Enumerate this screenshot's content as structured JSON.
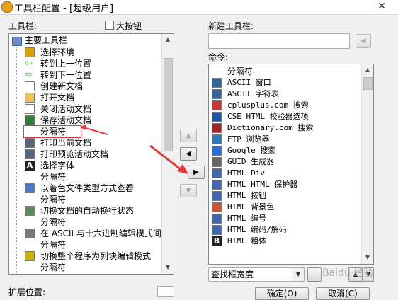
{
  "window": {
    "title": "工具栏配置 - [超级用户]",
    "close_glyph": "✕"
  },
  "left": {
    "toolbar_label": "工具栏:",
    "large_buttons_label": "大按钮",
    "tree_root": "主要工具栏",
    "items": [
      {
        "label": "选择环境",
        "icon": "environment-icon"
      },
      {
        "label": "转到上一位置",
        "icon": "back-arrow-icon"
      },
      {
        "label": "转到下一位置",
        "icon": "forward-arrow-icon"
      },
      {
        "label": "创建新文档",
        "icon": "new-document-icon"
      },
      {
        "label": "打开文档",
        "icon": "open-folder-icon"
      },
      {
        "label": "关闭活动文档",
        "icon": "close-document-icon"
      },
      {
        "label": "保存活动文档",
        "icon": "save-icon"
      },
      {
        "label": "分隔符",
        "icon": "separator"
      },
      {
        "label": "打印当前文档",
        "icon": "print-icon"
      },
      {
        "label": "打印预览活动文档",
        "icon": "print-preview-icon"
      },
      {
        "label": "选择字体",
        "icon": "font-icon"
      },
      {
        "label": "分隔符",
        "icon": "separator"
      },
      {
        "label": "以着色文件类型方式查看",
        "icon": "syntax-color-icon"
      },
      {
        "label": "分隔符",
        "icon": "separator"
      },
      {
        "label": "切换文档的自动换行状态",
        "icon": "word-wrap-icon"
      },
      {
        "label": "分隔符",
        "icon": "separator"
      },
      {
        "label": "在 ASCII 与十六进制编辑模式间",
        "icon": "hex-mode-icon"
      },
      {
        "label": "分隔符",
        "icon": "separator"
      },
      {
        "label": "切换整个程序为列块编辑模式",
        "icon": "column-mode-icon"
      },
      {
        "label": "分隔符",
        "icon": "separator"
      }
    ],
    "extended_position_label": "扩展位置:"
  },
  "right": {
    "new_toolbar_label": "新建工具栏:",
    "new_toolbar_value": "",
    "commands_label": "命令:",
    "commands": [
      {
        "label": "分隔符",
        "icon": "separator",
        "mono": false
      },
      {
        "label": "ASCII 窗口",
        "icon": "ascii-window-icon",
        "mono": true
      },
      {
        "label": "ASCII 字符表",
        "icon": "ascii-table-icon",
        "mono": true
      },
      {
        "label": "cplusplus.com 搜索",
        "icon": "cplusplus-icon",
        "mono": true
      },
      {
        "label": "CSE HTML 校验器选项",
        "icon": "cse-html-icon",
        "mono": true
      },
      {
        "label": "Dictionary.com 搜索",
        "icon": "dictionary-icon",
        "mono": true
      },
      {
        "label": "FTP 浏览器",
        "icon": "ftp-icon",
        "mono": true
      },
      {
        "label": "Google 搜索",
        "icon": "google-icon",
        "mono": true
      },
      {
        "label": "GUID 生成器",
        "icon": "guid-icon",
        "mono": true
      },
      {
        "label": "HTML Div",
        "icon": "html-div-icon",
        "mono": true
      },
      {
        "label": "HTML HTML 保护器",
        "icon": "html-protect-icon",
        "mono": true
      },
      {
        "label": "HTML 按钮",
        "icon": "html-button-icon",
        "mono": true
      },
      {
        "label": "HTML 背景色",
        "icon": "html-bgcolor-icon",
        "mono": true
      },
      {
        "label": "HTML 编号",
        "icon": "html-number-icon",
        "mono": true
      },
      {
        "label": "HTML 编码/解码",
        "icon": "html-encode-icon",
        "mono": true
      },
      {
        "label": "HTML 粗体",
        "icon": "html-bold-icon",
        "mono": true
      }
    ],
    "filter_combo_value": "查找框宽度",
    "ok_label": "确定(O)",
    "cancel_label": "取消(C)"
  },
  "watermark": "Baidu 经验",
  "colors": {
    "annotation_red": "#e23a3a"
  }
}
